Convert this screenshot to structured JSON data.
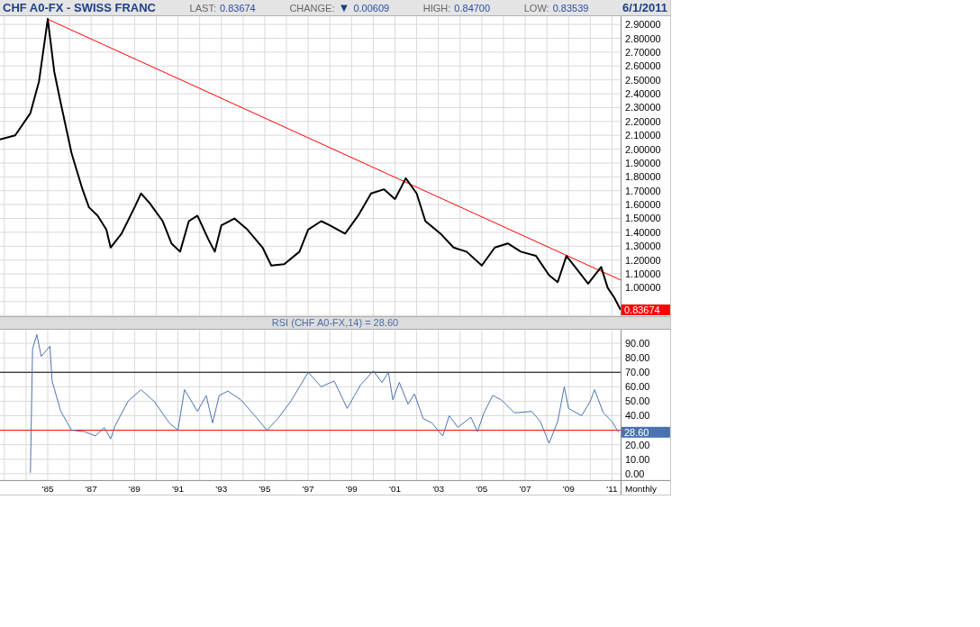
{
  "header": {
    "title": "CHF A0-FX - SWISS FRANC",
    "stats": [
      {
        "label": "LAST:",
        "value": "0.83674"
      },
      {
        "label": "CHANGE:",
        "value": "0.00609",
        "arrow": "▼"
      },
      {
        "label": "HIGH:",
        "value": "0.84700"
      },
      {
        "label": "LOW:",
        "value": "0.83539"
      }
    ],
    "date": "6/1/2011"
  },
  "price_chart": {
    "chart_data": {
      "type": "line",
      "grid": true,
      "xlim": [
        1982.8,
        2013.68
      ],
      "ylim": [
        0.796,
        2.958
      ],
      "x": [
        1982.8,
        1983.5,
        1984.2,
        1984.6,
        1985.0,
        1985.3,
        1985.6,
        1986.1,
        1986.6,
        1986.9,
        1987.3,
        1987.7,
        1987.9,
        1988.4,
        1989.0,
        1989.3,
        1989.7,
        1990.3,
        1990.7,
        1991.1,
        1991.5,
        1991.9,
        1992.4,
        1992.7,
        1993.0,
        1993.6,
        1994.2,
        1994.9,
        1995.3,
        1995.9,
        1996.6,
        1997.0,
        1997.6,
        1998.0,
        1998.7,
        1999.3,
        1999.9,
        2000.5,
        2001.0,
        2001.5,
        2002.0,
        2002.4,
        2003.1,
        2003.7,
        2004.3,
        2005.0,
        2005.6,
        2006.2,
        2006.8,
        2007.5,
        2008.1,
        2008.5,
        2008.9,
        2009.4,
        2009.9,
        2010.5,
        2010.8,
        2011.1,
        2011.4
      ],
      "series": [
        {
          "color": "#000000",
          "values": [
            2.07,
            2.1,
            2.26,
            2.49,
            2.94,
            2.56,
            2.33,
            1.97,
            1.71,
            1.58,
            1.52,
            1.42,
            1.29,
            1.39,
            1.58,
            1.68,
            1.61,
            1.48,
            1.32,
            1.26,
            1.48,
            1.52,
            1.35,
            1.26,
            1.45,
            1.5,
            1.42,
            1.29,
            1.16,
            1.17,
            1.26,
            1.42,
            1.48,
            1.45,
            1.39,
            1.52,
            1.68,
            1.71,
            1.64,
            1.79,
            1.68,
            1.48,
            1.39,
            1.29,
            1.26,
            1.16,
            1.29,
            1.32,
            1.26,
            1.23,
            1.09,
            1.04,
            1.23,
            1.13,
            1.03,
            1.15,
            1.0,
            0.93,
            0.84
          ]
        }
      ],
      "yticks": [
        {
          "value": 1.0,
          "label": "1.00000"
        },
        {
          "value": 1.1,
          "label": "1.10000"
        },
        {
          "value": 1.2,
          "label": "1.20000"
        },
        {
          "value": 1.3,
          "label": "1.30000"
        },
        {
          "value": 1.4,
          "label": "1.40000"
        },
        {
          "value": 1.5,
          "label": "1.50000"
        },
        {
          "value": 1.6,
          "label": "1.60000"
        },
        {
          "value": 1.7,
          "label": "1.70000"
        },
        {
          "value": 1.8,
          "label": "1.80000"
        },
        {
          "value": 1.9,
          "label": "1.90000"
        },
        {
          "value": 2.0,
          "label": "2.00000"
        },
        {
          "value": 2.1,
          "label": "2.10000"
        },
        {
          "value": 2.2,
          "label": "2.20000"
        },
        {
          "value": 2.3,
          "label": "2.30000"
        },
        {
          "value": 2.4,
          "label": "2.40000"
        },
        {
          "value": 2.5,
          "label": "2.50000"
        },
        {
          "value": 2.6,
          "label": "2.60000"
        },
        {
          "value": 2.7,
          "label": "2.70000"
        },
        {
          "value": 2.8,
          "label": "2.80000"
        },
        {
          "value": 2.9,
          "label": "2.90000"
        }
      ],
      "annotations": [
        "0.83674"
      ]
    }
  },
  "rsi_chart": {
    "chart_data": {
      "type": "line",
      "title": "RSI (CHF A0-FX,14) = 28.60",
      "xlabel": "Monthly",
      "grid": true,
      "xlim": [
        1982.8,
        2013.68
      ],
      "ylim": [
        -4.4,
        99.3
      ],
      "x": [
        1984.2,
        1984.3,
        1984.5,
        1984.7,
        1985.1,
        1985.2,
        1985.6,
        1986.1,
        1986.7,
        1987.2,
        1987.6,
        1987.9,
        1988.1,
        1988.7,
        1989.3,
        1989.9,
        1990.6,
        1991.0,
        1991.3,
        1991.9,
        1992.3,
        1992.6,
        1992.9,
        1993.3,
        1993.9,
        1994.6,
        1995.1,
        1995.6,
        1996.2,
        1997.0,
        1997.6,
        1998.2,
        1998.8,
        1999.4,
        2000.0,
        2000.4,
        2000.7,
        2000.9,
        2001.2,
        2001.6,
        2001.9,
        2002.3,
        2002.7,
        2003.2,
        2003.5,
        2003.9,
        2004.5,
        2004.8,
        2005.1,
        2005.5,
        2005.9,
        2006.5,
        2007.3,
        2007.7,
        2008.1,
        2008.5,
        2008.8,
        2009.0,
        2009.6,
        2010.0,
        2010.2,
        2010.6,
        2011.0,
        2011.3
      ],
      "series": [
        {
          "color": "#4a72b0",
          "values": [
            0.6,
            86,
            96,
            81,
            88,
            64,
            43,
            30,
            29,
            26,
            32,
            24,
            33,
            50,
            58,
            50,
            35,
            30,
            58,
            43,
            54,
            35,
            54,
            57,
            51,
            39,
            30,
            38,
            50,
            70,
            60,
            64,
            45,
            61,
            71,
            63,
            70,
            51,
            63,
            48,
            55,
            38,
            35,
            26,
            40,
            32,
            39,
            29,
            42,
            54,
            51,
            42,
            43,
            36,
            21,
            36,
            60,
            45,
            40,
            50,
            58,
            42,
            36,
            28.6
          ]
        }
      ],
      "xticks": [
        {
          "value": 1985,
          "label": "'85"
        },
        {
          "value": 1987,
          "label": "'87"
        },
        {
          "value": 1989,
          "label": "'89"
        },
        {
          "value": 1991,
          "label": "'91"
        },
        {
          "value": 1993,
          "label": "'93"
        },
        {
          "value": 1995,
          "label": "'95"
        },
        {
          "value": 1997,
          "label": "'97"
        },
        {
          "value": 1999,
          "label": "'99"
        },
        {
          "value": 2001,
          "label": "'01"
        },
        {
          "value": 2003,
          "label": "'03"
        },
        {
          "value": 2005,
          "label": "'05"
        },
        {
          "value": 2007,
          "label": "'07"
        },
        {
          "value": 2009,
          "label": "'09"
        },
        {
          "value": 2011,
          "label": "'11"
        }
      ],
      "yticks": [
        {
          "value": 0,
          "label": "0.00"
        },
        {
          "value": 10,
          "label": "10.00"
        },
        {
          "value": 20,
          "label": "20.00"
        },
        {
          "value": 40,
          "label": "40.00"
        },
        {
          "value": 50,
          "label": "50.00"
        },
        {
          "value": 60,
          "label": "60.00"
        },
        {
          "value": 70,
          "label": "70.00"
        },
        {
          "value": 80,
          "label": "80.00"
        },
        {
          "value": 90,
          "label": "90.00"
        }
      ],
      "ref_lines": [
        {
          "axis": "y",
          "value": 70,
          "color": "#000000"
        },
        {
          "axis": "y",
          "value": 30,
          "color": "#ff0000"
        }
      ],
      "annotations": [
        "28.60"
      ]
    }
  }
}
